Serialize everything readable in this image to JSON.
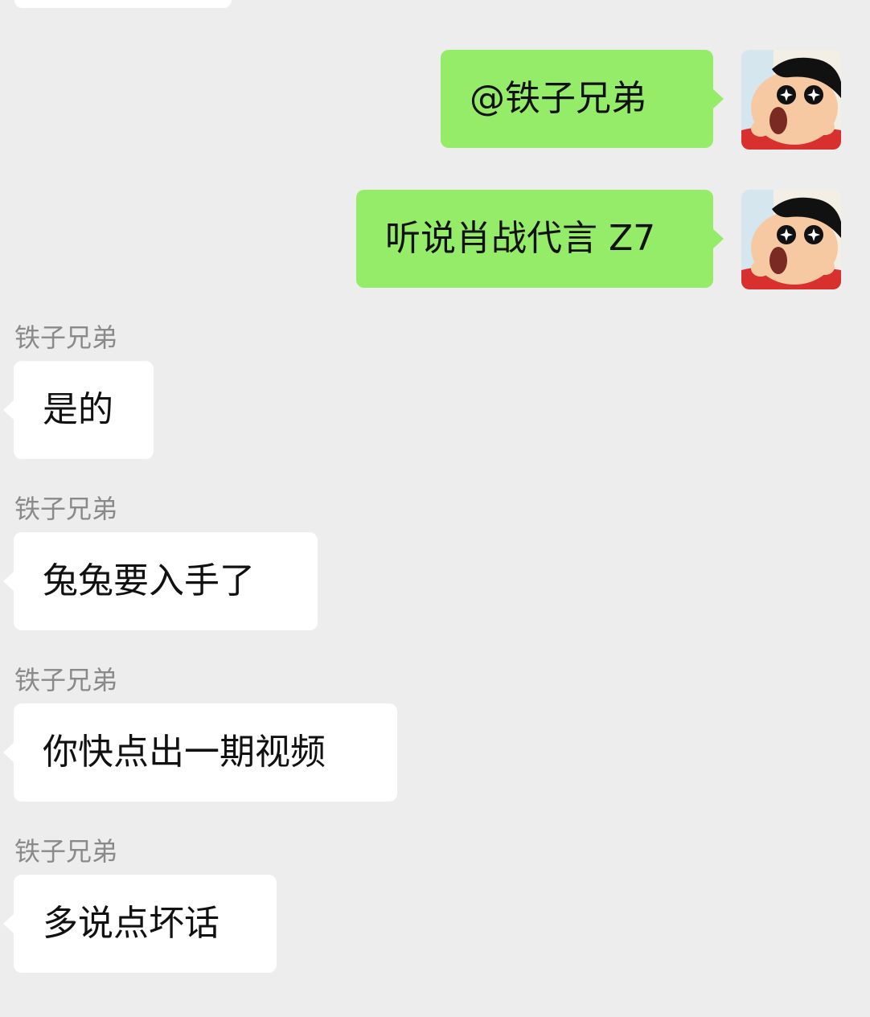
{
  "chat": {
    "outgoing": [
      {
        "text": "@铁子兄弟"
      },
      {
        "text": "听说肖战代言 Z7"
      }
    ],
    "incoming": [
      {
        "sender": "铁子兄弟",
        "text": "是的"
      },
      {
        "sender": "铁子兄弟",
        "text": "兔兔要入手了"
      },
      {
        "sender": "铁子兄弟",
        "text": "你快点出一期视频"
      },
      {
        "sender": "铁子兄弟",
        "text": "多说点坏话"
      }
    ]
  },
  "colors": {
    "background": "#ededed",
    "outgoing_bubble": "#95ec69",
    "incoming_bubble": "#ffffff",
    "sender_name": "#8a8a8a",
    "text": "#111111"
  },
  "icons": {
    "my_avatar": "cartoon-boy-avatar-icon"
  }
}
